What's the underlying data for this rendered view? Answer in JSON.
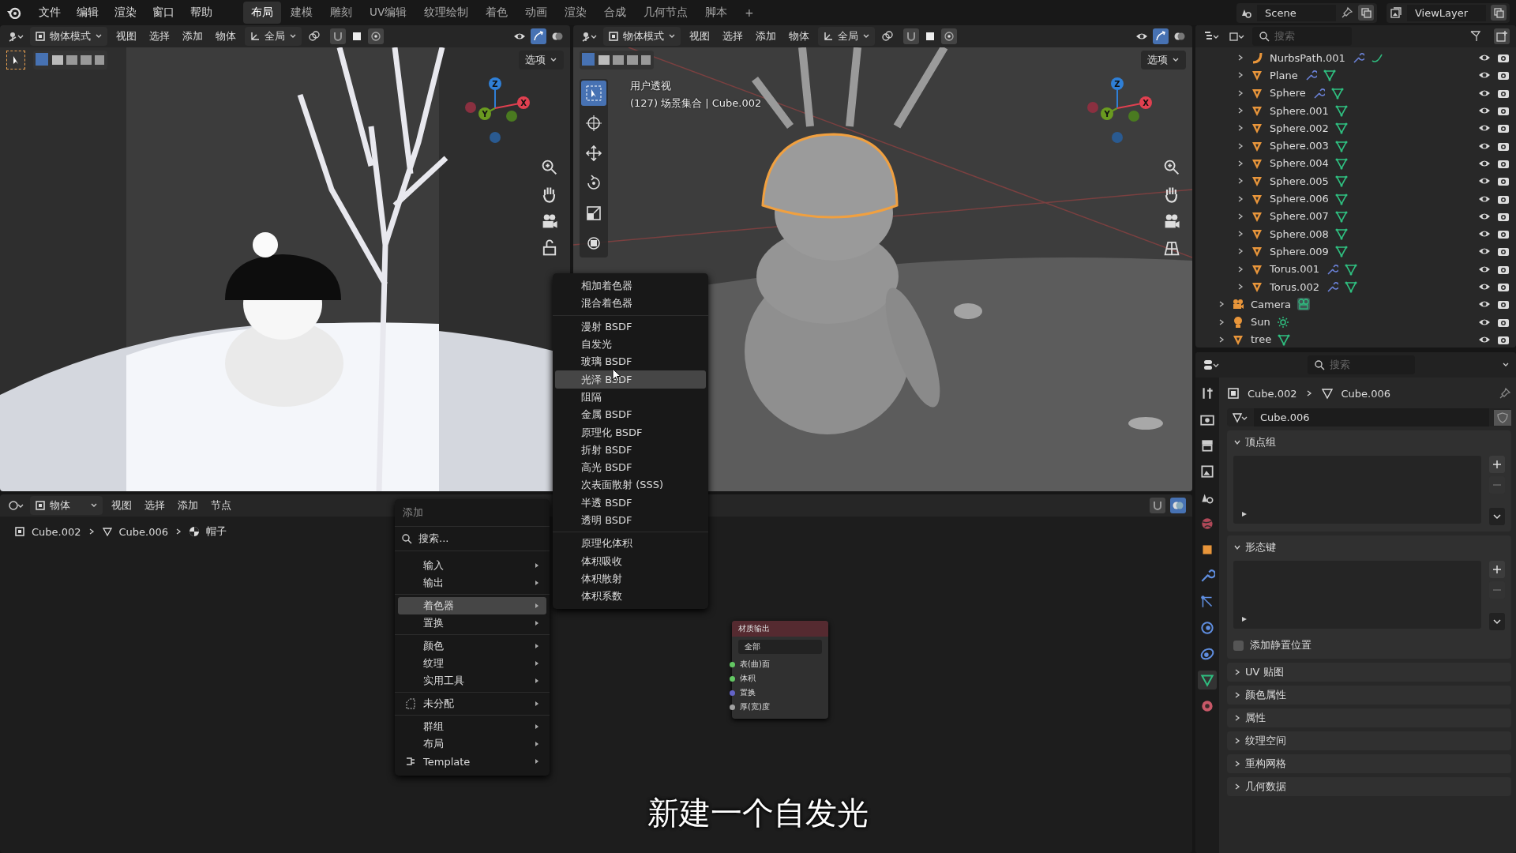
{
  "top_menu": [
    "文件",
    "编辑",
    "渲染",
    "窗口",
    "帮助"
  ],
  "workspaces": [
    {
      "label": "布局",
      "selected": true
    },
    {
      "label": "建模",
      "selected": false
    },
    {
      "label": "雕刻",
      "selected": false
    },
    {
      "label": "UV编辑",
      "selected": false
    },
    {
      "label": "纹理绘制",
      "selected": false
    },
    {
      "label": "着色",
      "selected": false
    },
    {
      "label": "动画",
      "selected": false
    },
    {
      "label": "渲染",
      "selected": false
    },
    {
      "label": "合成",
      "selected": false
    },
    {
      "label": "几何节点",
      "selected": false
    },
    {
      "label": "脚本",
      "selected": false
    }
  ],
  "add_workspace": "+",
  "scene": "Scene",
  "view_layer": "ViewLayer",
  "viewports": [
    {
      "mode": "物体模式",
      "menus": [
        "视图",
        "选择",
        "添加",
        "物体"
      ],
      "orientation": "全局",
      "options": "选项",
      "gizmo": [
        "Z",
        "Y",
        "X"
      ]
    },
    {
      "mode": "物体模式",
      "menus": [
        "视图",
        "选择",
        "添加",
        "物体"
      ],
      "orientation": "全局",
      "options": "选项",
      "gizmo": [
        "Z",
        "Y",
        "X"
      ],
      "overlay_title": "用户透视",
      "overlay_info": "(127) 场景集合 | Cube.002"
    }
  ],
  "node_editor": {
    "mode": "物体",
    "menus": [
      "视图",
      "选择",
      "添加",
      "节点"
    ],
    "breadcrumb": [
      "Cube.002",
      "Cube.006",
      "帽子"
    ],
    "node": {
      "title": "材质输出",
      "target": "全部",
      "sockets": [
        {
          "label": "表(曲)面",
          "color": "#63c763"
        },
        {
          "label": "体积",
          "color": "#63c763"
        },
        {
          "label": "置换",
          "color": "#6363c7"
        },
        {
          "label": "厚(宽)度",
          "color": "#a1a1a1"
        }
      ]
    }
  },
  "add_menu": {
    "title": "添加",
    "search": "搜索...",
    "groups": [
      [
        {
          "label": "输入",
          "selected": false
        },
        {
          "label": "输出",
          "selected": false
        }
      ],
      [
        {
          "label": "着色器",
          "selected": true
        },
        {
          "label": "置换",
          "selected": false
        }
      ],
      [
        {
          "label": "颜色",
          "selected": false
        },
        {
          "label": "纹理",
          "selected": false
        },
        {
          "label": "实用工具",
          "selected": false
        }
      ],
      [
        {
          "label": "未分配",
          "selected": false
        }
      ],
      [
        {
          "label": "群组",
          "selected": false
        },
        {
          "label": "布局",
          "selected": false
        },
        {
          "label": "Template",
          "selected": false
        }
      ]
    ]
  },
  "shader_menu": {
    "groups": [
      [
        {
          "label": "相加着色器",
          "selected": false
        },
        {
          "label": "混合着色器",
          "selected": false
        }
      ],
      [
        {
          "label": "漫射 BSDF",
          "selected": false
        },
        {
          "label": "自发光",
          "selected": false
        },
        {
          "label": "玻璃 BSDF",
          "selected": false
        },
        {
          "label": "光泽 BSDF",
          "selected": true
        },
        {
          "label": "阻隔",
          "selected": false
        },
        {
          "label": "金属 BSDF",
          "selected": false
        },
        {
          "label": "原理化 BSDF",
          "selected": false
        },
        {
          "label": "折射 BSDF",
          "selected": false
        },
        {
          "label": "高光 BSDF",
          "selected": false
        },
        {
          "label": "次表面散射 (SSS)",
          "selected": false
        },
        {
          "label": "半透 BSDF",
          "selected": false
        },
        {
          "label": "透明 BSDF",
          "selected": false
        }
      ],
      [
        {
          "label": "原理化体积",
          "selected": false
        },
        {
          "label": "体积吸收",
          "selected": false
        },
        {
          "label": "体积散射",
          "selected": false
        },
        {
          "label": "体积系数",
          "selected": false
        }
      ]
    ]
  },
  "outliner": {
    "search_placeholder": "搜索",
    "nested_items": [
      {
        "name": "NurbsPath.001",
        "kind": "curve",
        "modifier": true
      },
      {
        "name": "Plane",
        "kind": "mesh",
        "modifier": true
      },
      {
        "name": "Sphere",
        "kind": "mesh",
        "modifier": true
      },
      {
        "name": "Sphere.001",
        "kind": "mesh",
        "modifier": false
      },
      {
        "name": "Sphere.002",
        "kind": "mesh",
        "modifier": false
      },
      {
        "name": "Sphere.003",
        "kind": "mesh",
        "modifier": false
      },
      {
        "name": "Sphere.004",
        "kind": "mesh",
        "modifier": false
      },
      {
        "name": "Sphere.005",
        "kind": "mesh",
        "modifier": false
      },
      {
        "name": "Sphere.006",
        "kind": "mesh",
        "modifier": false
      },
      {
        "name": "Sphere.007",
        "kind": "mesh",
        "modifier": false
      },
      {
        "name": "Sphere.008",
        "kind": "mesh",
        "modifier": false
      },
      {
        "name": "Sphere.009",
        "kind": "mesh",
        "modifier": false
      },
      {
        "name": "Torus.001",
        "kind": "mesh",
        "modifier": true
      },
      {
        "name": "Torus.002",
        "kind": "mesh",
        "modifier": true
      }
    ],
    "items": [
      {
        "name": "Camera",
        "kind": "camera"
      },
      {
        "name": "Sun",
        "kind": "light"
      },
      {
        "name": "tree",
        "kind": "mesh"
      }
    ]
  },
  "properties": {
    "search_placeholder": "搜索",
    "breadcrumb": [
      "Cube.002",
      "Cube.006"
    ],
    "data_name": "Cube.006",
    "list_panels": [
      {
        "title": "顶点组",
        "expanded": true
      },
      {
        "title": "形态键",
        "expanded": true
      }
    ],
    "rest_position": {
      "label": "添加静置位置",
      "checked": false
    },
    "collapsed_panels": [
      {
        "title": "UV 贴图",
        "expanded": false
      },
      {
        "title": "颜色属性",
        "expanded": false
      },
      {
        "title": "属性",
        "expanded": false
      },
      {
        "title": "纹理空间",
        "expanded": false
      },
      {
        "title": "重构网格",
        "expanded": false
      },
      {
        "title": "几何数据",
        "expanded": false
      }
    ]
  },
  "subtitle": "新建一个自发光"
}
